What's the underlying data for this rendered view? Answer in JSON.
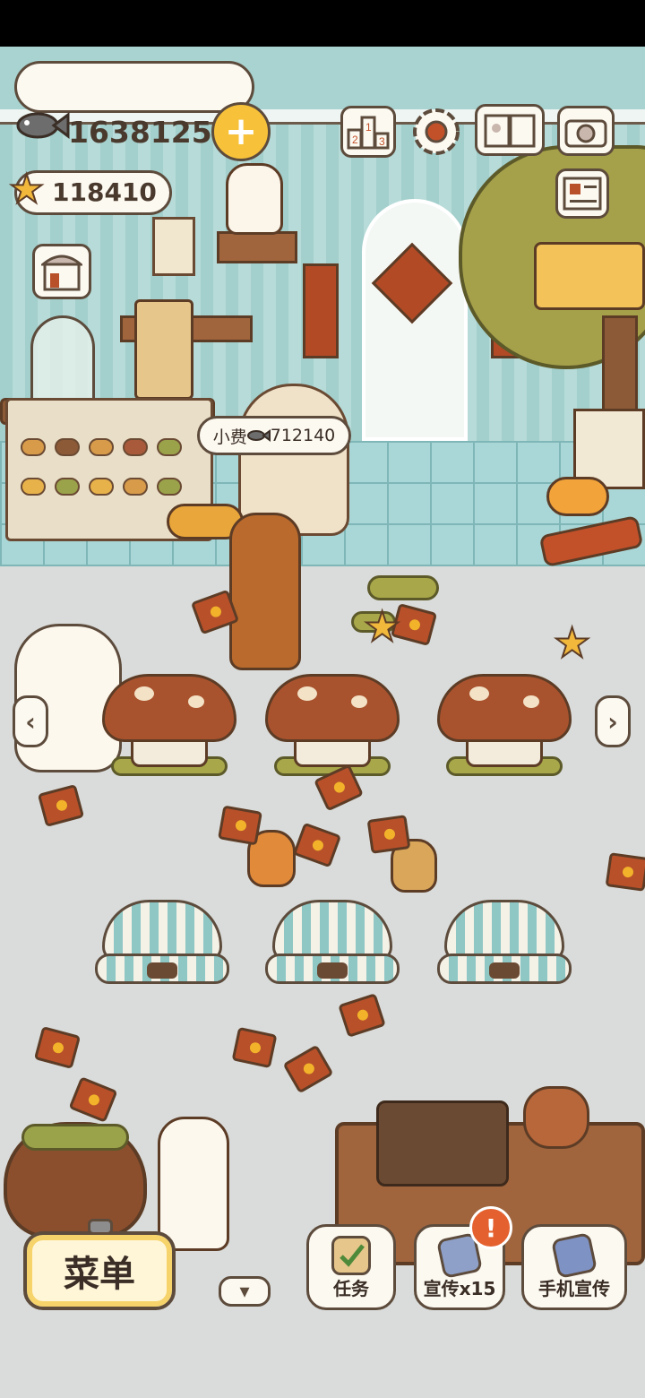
{
  "currency": {
    "fish_icon": "fish-icon",
    "fish_amount": "16381259",
    "star_icon": "star-icon",
    "star_amount": "118410",
    "add_button_icon": "plus-icon"
  },
  "top_bar": {
    "ranking_icon": "podium-icon",
    "settings_icon": "gear-icon",
    "book_icon": "recipe-book-icon",
    "camera_icon": "camera-icon",
    "newspaper_icon": "newspaper-icon",
    "shop_icon": "shop-icon"
  },
  "tip_bubble": {
    "label": "小费",
    "icon": "fish-icon",
    "amount": "712140"
  },
  "navigation": {
    "left_arrow": "‹",
    "right_arrow": "›",
    "collapse": "▾"
  },
  "bottom_bar": {
    "menu_label": "菜单",
    "tasks_label": "任务",
    "promote_label": "宣传x15",
    "alert_mark": "!",
    "phone_promote_label": "手机宣传"
  },
  "colors": {
    "wall": "#a8d3d0",
    "floor": "#d9dcda",
    "accent_yellow": "#f7c23a",
    "envelope_red": "#b8502a",
    "outline": "#5d4b3c",
    "alert": "#e4612f"
  }
}
